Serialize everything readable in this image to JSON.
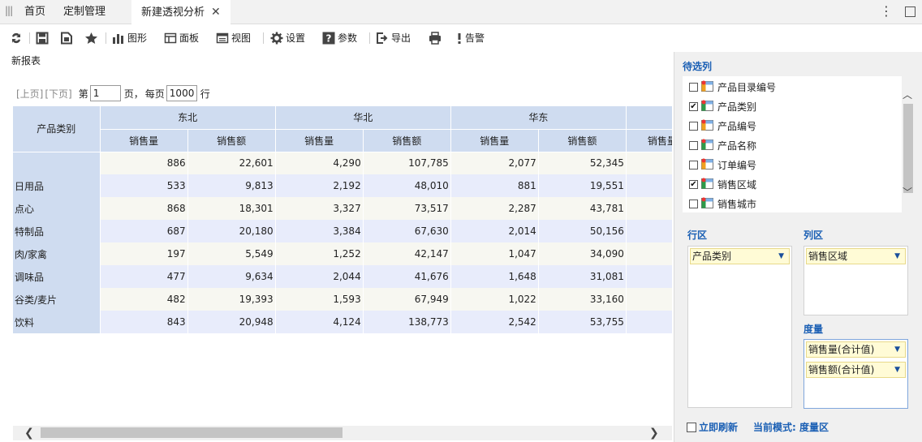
{
  "tabs": {
    "home": "首页",
    "custom": "定制管理",
    "active": "新建透视分析"
  },
  "toolbar": {
    "chart": "图形",
    "panel": "面板",
    "view": "视图",
    "settings": "设置",
    "params": "参数",
    "export": "导出",
    "alert": "告警"
  },
  "report_title": "新报表",
  "pager": {
    "prev": "[上页]",
    "next": "[下页]",
    "page_prefix": "第",
    "page_value": "1",
    "page_suffix": "页，",
    "per_page_prefix": "每页",
    "per_page_value": "1000",
    "per_page_suffix": "行"
  },
  "grid": {
    "row_header": "产品类别",
    "regions": [
      "东北",
      "华北",
      "华东",
      ""
    ],
    "measures": [
      "销售量",
      "销售额",
      "销售量",
      "销售额",
      "销售量",
      "销售额",
      "销售量"
    ],
    "rows": [
      {
        "label": "",
        "values": [
          "886",
          "22,601",
          "4,290",
          "107,785",
          "2,077",
          "52,345",
          ""
        ]
      },
      {
        "label": "日用品",
        "values": [
          "533",
          "9,813",
          "2,192",
          "48,010",
          "881",
          "19,551",
          ""
        ]
      },
      {
        "label": "点心",
        "values": [
          "868",
          "18,301",
          "3,327",
          "73,517",
          "2,287",
          "43,781",
          ""
        ]
      },
      {
        "label": "特制品",
        "values": [
          "687",
          "20,180",
          "3,384",
          "67,630",
          "2,014",
          "50,156",
          ""
        ]
      },
      {
        "label": "肉/家禽",
        "values": [
          "197",
          "5,549",
          "1,252",
          "42,147",
          "1,047",
          "34,090",
          ""
        ]
      },
      {
        "label": "调味品",
        "values": [
          "477",
          "9,634",
          "2,044",
          "41,676",
          "1,648",
          "31,081",
          ""
        ]
      },
      {
        "label": "谷类/麦片",
        "values": [
          "482",
          "19,393",
          "1,593",
          "67,949",
          "1,022",
          "33,160",
          ""
        ]
      },
      {
        "label": "饮料",
        "values": [
          "843",
          "20,948",
          "4,124",
          "138,773",
          "2,542",
          "53,755",
          ""
        ]
      }
    ]
  },
  "panel": {
    "candidates_title": "待选列",
    "fields": [
      {
        "label": "产品目录编号",
        "checked": "",
        "icon": "orange"
      },
      {
        "label": "产品类别",
        "checked": "✔",
        "icon": "green"
      },
      {
        "label": "产品编号",
        "checked": "",
        "icon": "orange"
      },
      {
        "label": "产品名称",
        "checked": "",
        "icon": "green"
      },
      {
        "label": "订单编号",
        "checked": "",
        "icon": "orange"
      },
      {
        "label": "销售区域",
        "checked": "✔",
        "icon": "green"
      },
      {
        "label": "销售城市",
        "checked": "",
        "icon": "green"
      }
    ],
    "row_area_title": "行区",
    "col_area_title": "列区",
    "measure_area_title": "度量",
    "row_chip": "产品类别",
    "col_chip": "销售区域",
    "measure_chips": [
      "销售量(合计值)",
      "销售额(合计值)"
    ],
    "refresh_label": "立即刷新",
    "mode_label": "当前模式: 度量区"
  },
  "colors": {
    "accent": "#1a5fb4",
    "header_bg": "#cfdcf0",
    "chip_bg": "#fffbd6"
  }
}
